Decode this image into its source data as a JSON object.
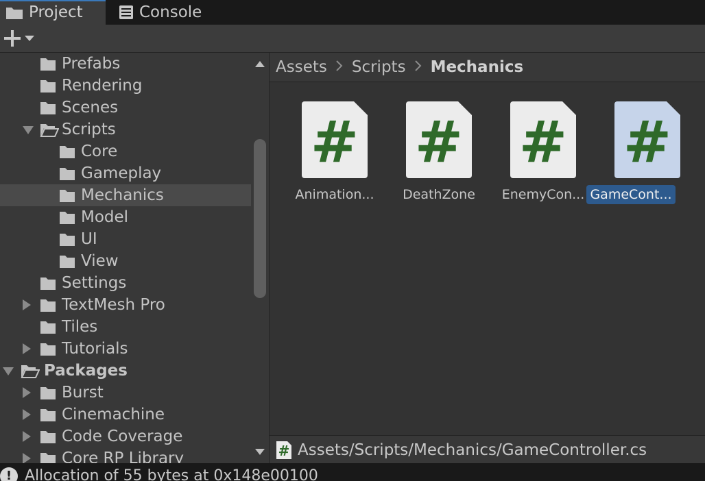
{
  "tabs": [
    {
      "label": "Project",
      "icon": "folder-icon",
      "active": true
    },
    {
      "label": "Console",
      "icon": "console-icon",
      "active": false
    }
  ],
  "toolbar": {
    "add_icon": "plus-icon",
    "dropdown_icon": "caret-down-icon"
  },
  "tree": {
    "items": [
      {
        "label": "Prefabs",
        "depth": 1,
        "expander": "none",
        "open": false
      },
      {
        "label": "Rendering",
        "depth": 1,
        "expander": "none",
        "open": false
      },
      {
        "label": "Scenes",
        "depth": 1,
        "expander": "none",
        "open": false
      },
      {
        "label": "Scripts",
        "depth": 1,
        "expander": "expanded",
        "open": true
      },
      {
        "label": "Core",
        "depth": 2,
        "expander": "none",
        "open": false
      },
      {
        "label": "Gameplay",
        "depth": 2,
        "expander": "none",
        "open": false
      },
      {
        "label": "Mechanics",
        "depth": 2,
        "expander": "none",
        "open": false,
        "selected": true
      },
      {
        "label": "Model",
        "depth": 2,
        "expander": "none",
        "open": false
      },
      {
        "label": "UI",
        "depth": 2,
        "expander": "none",
        "open": false
      },
      {
        "label": "View",
        "depth": 2,
        "expander": "none",
        "open": false
      },
      {
        "label": "Settings",
        "depth": 1,
        "expander": "none",
        "open": false
      },
      {
        "label": "TextMesh Pro",
        "depth": 1,
        "expander": "collapsed",
        "open": false
      },
      {
        "label": "Tiles",
        "depth": 1,
        "expander": "none",
        "open": false
      },
      {
        "label": "Tutorials",
        "depth": 1,
        "expander": "collapsed",
        "open": false
      },
      {
        "label": "Packages",
        "depth": 0,
        "expander": "expanded",
        "open": true,
        "bold": true
      },
      {
        "label": "Burst",
        "depth": 1,
        "expander": "collapsed",
        "open": false
      },
      {
        "label": "Cinemachine",
        "depth": 1,
        "expander": "collapsed",
        "open": false
      },
      {
        "label": "Code Coverage",
        "depth": 1,
        "expander": "collapsed",
        "open": false
      },
      {
        "label": "Core RP Library",
        "depth": 1,
        "expander": "collapsed",
        "open": false
      }
    ]
  },
  "breadcrumb": {
    "items": [
      "Assets",
      "Scripts",
      "Mechanics"
    ],
    "separator": ">"
  },
  "assets": [
    {
      "name": "Animation...",
      "icon": "csharp-script-icon",
      "glyph": "#",
      "selected": false
    },
    {
      "name": "DeathZone",
      "icon": "csharp-script-icon",
      "glyph": "#",
      "selected": false
    },
    {
      "name": "EnemyCon...",
      "icon": "csharp-script-icon",
      "glyph": "#",
      "selected": false
    },
    {
      "name": "GameCont...",
      "icon": "csharp-script-icon",
      "glyph": "#",
      "selected": true
    }
  ],
  "pathbar": {
    "icon_glyph": "#",
    "path": "Assets/Scripts/Mechanics/GameController.cs"
  },
  "statusbar": {
    "icon_glyph": "!",
    "message": "Allocation of 55 bytes at 0x148e00100"
  },
  "colors": {
    "accent": "#3a79bb",
    "selection": "#2d5a8d",
    "script_icon_green": "#2f6a2a",
    "folder_gray": "#c2c2c2"
  }
}
